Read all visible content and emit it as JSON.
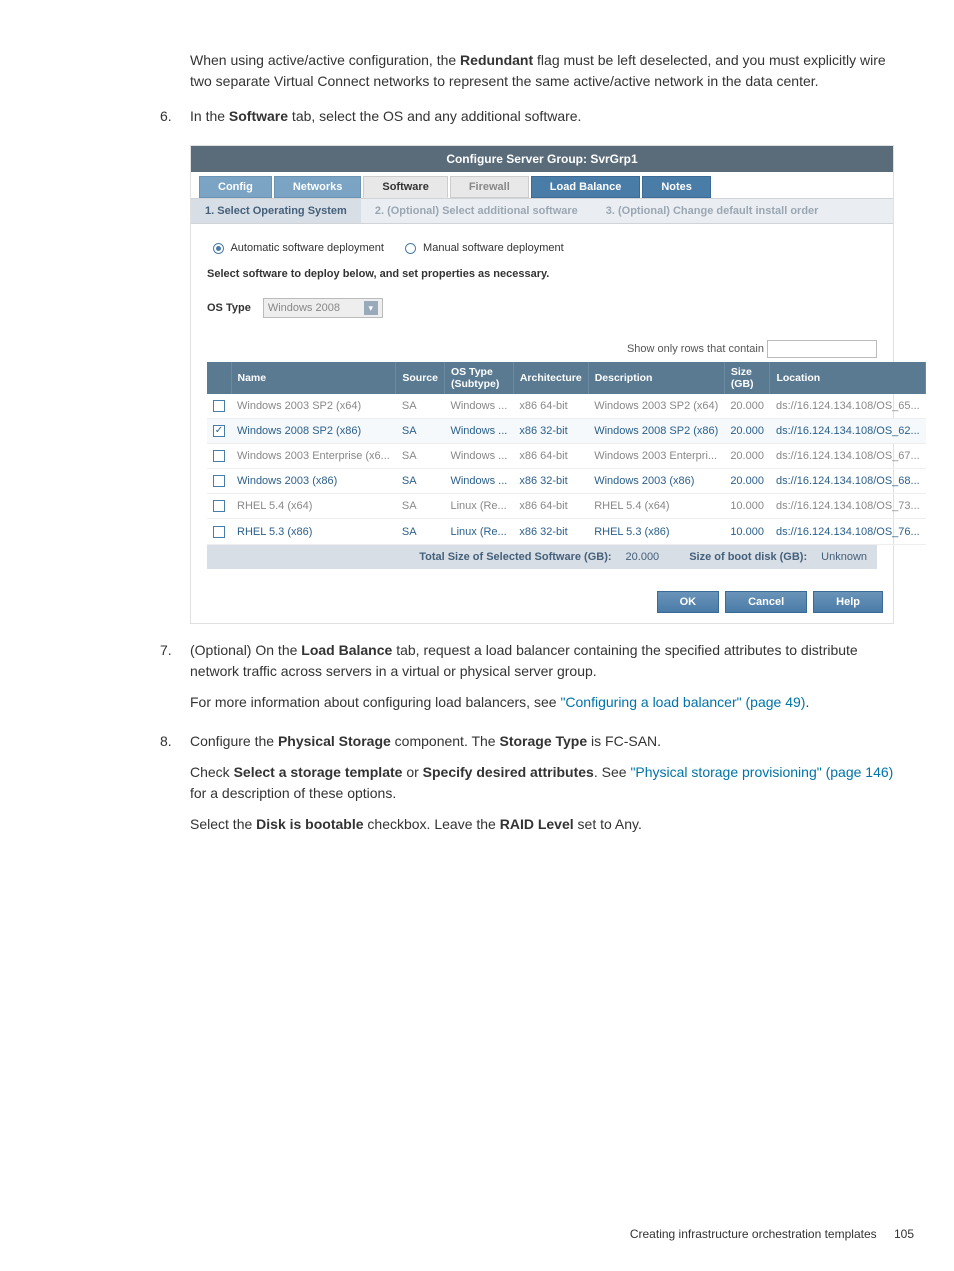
{
  "para_top": "When using active/active configuration, the <b>Redundant</b> flag must be left deselected, and you must explicitly wire two separate Virtual Connect networks to represent the same active/active network in the data center.",
  "step6_num": "6.",
  "step6_pre": "In the ",
  "step6_bold": "Software",
  "step6_post": " tab, select the OS and any additional software.",
  "dialog": {
    "title": "Configure Server Group: SvrGrp1",
    "tabs": [
      "Config",
      "Networks",
      "Software",
      "Firewall",
      "Load Balance",
      "Notes"
    ],
    "active_tab": 2,
    "subtabs": [
      "1. Select Operating System",
      "2. (Optional) Select additional software",
      "3. (Optional) Change default install order"
    ],
    "radio": {
      "auto": "Automatic software deployment",
      "manual": "Manual software deployment"
    },
    "instr": "Select software to deploy below, and set properties as necessary.",
    "os_type_label": "OS Type",
    "os_type_value": "Windows 2008",
    "filter_label": "Show only rows that contain",
    "columns": [
      "Name",
      "Source",
      "OS Type (Subtype)",
      "Architecture",
      "Description",
      "Size (GB)",
      "Location"
    ],
    "rows": [
      {
        "checked": false,
        "dim": true,
        "name": "Windows 2003 SP2 (x64)",
        "src": "SA",
        "ost": "Windows ...",
        "arch": "x86 64-bit",
        "desc": "Windows 2003 SP2 (x64)",
        "size": "20.000",
        "loc": "ds://16.124.134.108/OS_65..."
      },
      {
        "checked": true,
        "dim": false,
        "name": "Windows 2008 SP2 (x86)",
        "src": "SA",
        "ost": "Windows ...",
        "arch": "x86 32-bit",
        "desc": "Windows 2008 SP2 (x86)",
        "size": "20.000",
        "loc": "ds://16.124.134.108/OS_62..."
      },
      {
        "checked": false,
        "dim": true,
        "name": "Windows 2003 Enterprise (x6...",
        "src": "SA",
        "ost": "Windows ...",
        "arch": "x86 64-bit",
        "desc": "Windows 2003 Enterpri...",
        "size": "20.000",
        "loc": "ds://16.124.134.108/OS_67..."
      },
      {
        "checked": false,
        "dim": false,
        "name": "Windows 2003 (x86)",
        "src": "SA",
        "ost": "Windows ...",
        "arch": "x86 32-bit",
        "desc": "Windows 2003 (x86)",
        "size": "20.000",
        "loc": "ds://16.124.134.108/OS_68..."
      },
      {
        "checked": false,
        "dim": true,
        "name": "RHEL 5.4 (x64)",
        "src": "SA",
        "ost": "Linux (Re...",
        "arch": "x86 64-bit",
        "desc": "RHEL 5.4 (x64)",
        "size": "10.000",
        "loc": "ds://16.124.134.108/OS_73..."
      },
      {
        "checked": false,
        "dim": false,
        "name": "RHEL 5.3 (x86)",
        "src": "SA",
        "ost": "Linux (Re...",
        "arch": "x86 32-bit",
        "desc": "RHEL 5.3 (x86)",
        "size": "10.000",
        "loc": "ds://16.124.134.108/OS_76..."
      }
    ],
    "total_label": "Total Size of Selected Software (GB):",
    "total_value": "20.000",
    "boot_label": "Size of boot disk (GB):",
    "boot_value": "Unknown",
    "buttons": {
      "ok": "OK",
      "cancel": "Cancel",
      "help": "Help"
    }
  },
  "step7_num": "7.",
  "step7_p1a": "(Optional) On the ",
  "step7_p1b": "Load Balance",
  "step7_p1c": " tab, request a load balancer containing the specified attributes to distribute network traffic across servers in a virtual or physical server group.",
  "step7_p2a": "For more information about configuring load balancers, see ",
  "step7_link": "\"Configuring a load balancer\" (page 49)",
  "step7_p2b": ".",
  "step8_num": "8.",
  "step8_p1a": "Configure the ",
  "step8_p1b": "Physical Storage",
  "step8_p1c": " component. The ",
  "step8_p1d": "Storage Type",
  "step8_p1e": " is FC-SAN.",
  "step8_p2a": "Check ",
  "step8_p2b": "Select a storage template",
  "step8_p2c": " or ",
  "step8_p2d": "Specify desired attributes",
  "step8_p2e": ". See ",
  "step8_link": "\"Physical storage provisioning\" (page 146)",
  "step8_p2f": " for a description of these options.",
  "step8_p3a": "Select the ",
  "step8_p3b": "Disk is bootable",
  "step8_p3c": " checkbox. Leave the ",
  "step8_p3d": "RAID Level",
  "step8_p3e": " set to Any.",
  "footer_text": "Creating infrastructure orchestration templates",
  "footer_page": "105"
}
